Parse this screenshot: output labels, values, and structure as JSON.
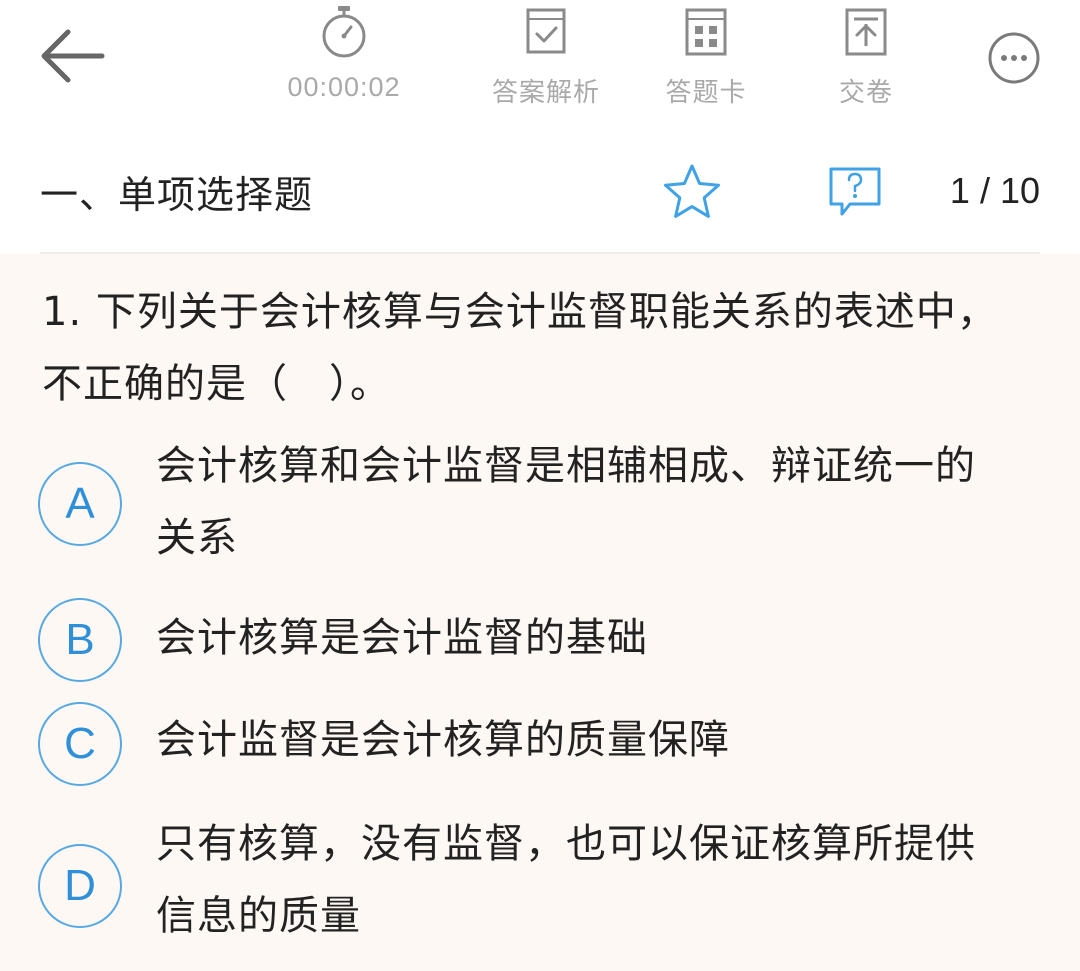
{
  "toolbar": {
    "timer": "00:00:02",
    "analysis_label": "答案解析",
    "answer_card_label": "答题卡",
    "submit_label": "交卷"
  },
  "section": {
    "title": "一、单项选择题",
    "counter": "1 / 10"
  },
  "question": {
    "text": "1. 下列关于会计核算与会计监督职能关系的表述中，不正确的是（　）。",
    "options": [
      {
        "letter": "A",
        "text": "会计核算和会计监督是相辅相成、辩证统一的关系"
      },
      {
        "letter": "B",
        "text": "会计核算是会计监督的基础"
      },
      {
        "letter": "C",
        "text": "会计监督是会计核算的质量保障"
      },
      {
        "letter": "D",
        "text": "只有核算，没有监督，也可以保证核算所提供信息的质量"
      }
    ]
  },
  "colors": {
    "accent": "#2f8fd8",
    "muted": "#a9a9a9",
    "question_bg": "#fdf8f3"
  }
}
